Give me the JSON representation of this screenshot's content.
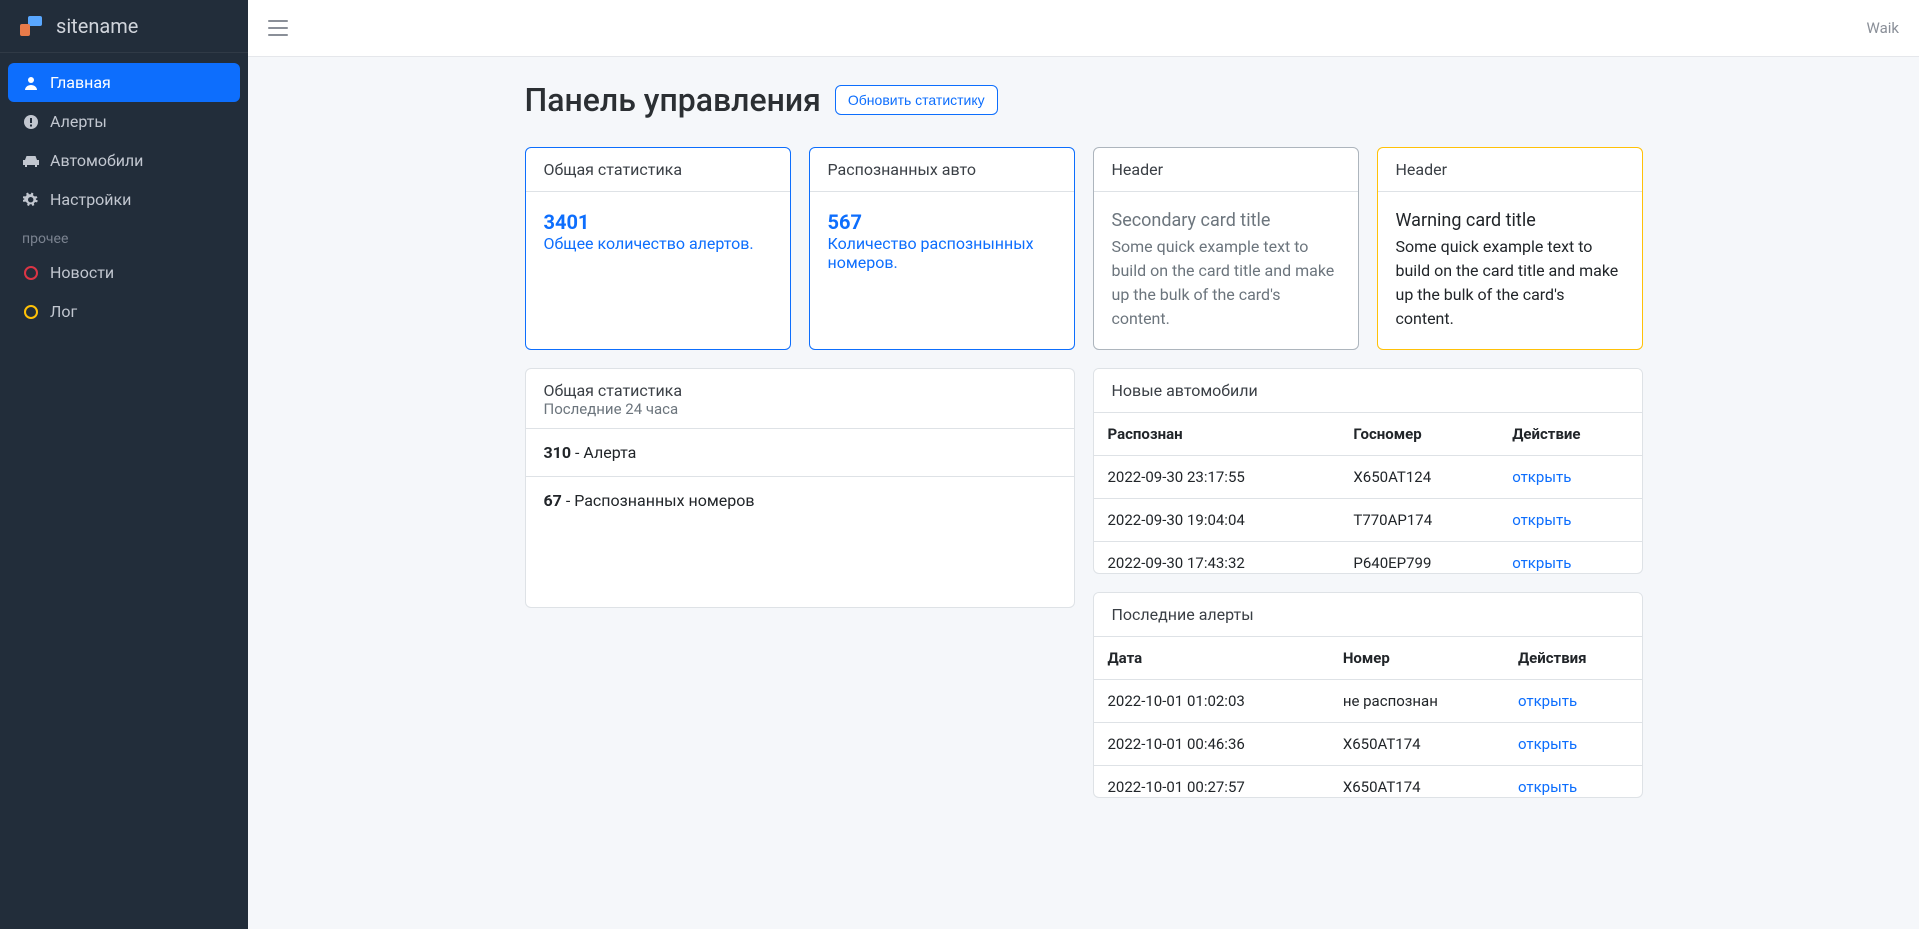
{
  "brand": {
    "title": "sitename"
  },
  "sidebar": {
    "items": [
      {
        "label": "Главная",
        "icon": "user-icon",
        "active": true
      },
      {
        "label": "Алерты",
        "icon": "alert-icon",
        "active": false
      },
      {
        "label": "Автомобили",
        "icon": "car-icon",
        "active": false
      },
      {
        "label": "Настройки",
        "icon": "gear-icon",
        "active": false
      }
    ],
    "section_label": "прочее",
    "secondary": [
      {
        "label": "Новости",
        "color": "red"
      },
      {
        "label": "Лог",
        "color": "yellow"
      }
    ]
  },
  "topbar": {
    "username": "Waik"
  },
  "page": {
    "title": "Панель управления",
    "refresh_label": "Обновить статистику"
  },
  "stat_cards": [
    {
      "header": "Общая статистика",
      "value": "3401",
      "desc": "Общее количество алертов.",
      "variant": "primary"
    },
    {
      "header": "Распознанных авто",
      "value": "567",
      "desc": "Количество распознынных номеров.",
      "variant": "primary"
    },
    {
      "header": "Header",
      "title": "Secondary card title",
      "text": "Some quick example text to build on the card title and make up the bulk of the card's content.",
      "variant": "secondary"
    },
    {
      "header": "Header",
      "title": "Warning card title",
      "text": "Some quick example text to build on the card title and make up the bulk of the card's content.",
      "variant": "warning"
    }
  ],
  "summary24": {
    "header": "Общая статистика",
    "subheader": "Последние 24 часа",
    "rows": [
      {
        "value": "310",
        "label": " - Алерта"
      },
      {
        "value": "67",
        "label": " - Распознанных номеров"
      }
    ]
  },
  "new_cars": {
    "header": "Новые автомобили",
    "columns": [
      "Распознан",
      "Госномер",
      "Действие"
    ],
    "action_label": "открыть",
    "rows": [
      {
        "time": "2022-09-30 23:17:55",
        "plate": "Х650АТ124"
      },
      {
        "time": "2022-09-30 19:04:04",
        "plate": "Т770АР174"
      },
      {
        "time": "2022-09-30 17:43:32",
        "plate": "Р640ЕР799"
      }
    ]
  },
  "recent_alerts": {
    "header": "Последние алерты",
    "columns": [
      "Дата",
      "Номер",
      "Действия"
    ],
    "action_label": "открыть",
    "rows": [
      {
        "time": "2022-10-01 01:02:03",
        "plate": "не распознан"
      },
      {
        "time": "2022-10-01 00:46:36",
        "plate": "Х650АТ174"
      },
      {
        "time": "2022-10-01 00:27:57",
        "plate": "Х650АТ174"
      }
    ]
  }
}
